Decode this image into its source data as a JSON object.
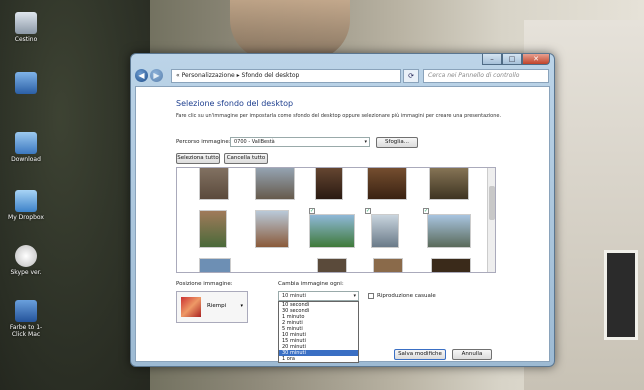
{
  "desktop": {
    "icons": [
      {
        "label": "Cestino",
        "icon": "recycle-bin-icon"
      },
      {
        "label": "",
        "icon": "computer-icon"
      },
      {
        "label": "Download",
        "icon": "download-folder-icon"
      },
      {
        "label": "My Dropbox",
        "icon": "dropbox-folder-icon"
      },
      {
        "label": "Skype ver.",
        "icon": "skype-icon"
      },
      {
        "label": "Farbe to 1-Click Mac",
        "icon": "shortcut-icon"
      }
    ]
  },
  "window": {
    "breadcrumb": "« Personalizzazione ▸ Sfondo del desktop",
    "search_placeholder": "Cerca nei Pannello di controllo",
    "title": "Selezione sfondo del desktop",
    "description": "Fare clic su un'immagine per impostarla come sfondo del desktop oppure selezionare più immagini per creare una presentazione.",
    "location_label": "Percorso immagine:",
    "location_value": "0700 - VallBestà",
    "browse_label": "Sfoglia...",
    "select_all_label": "Seleziona tutto",
    "clear_all_label": "Cancella tutto",
    "position_label": "Posizione immagine:",
    "position_value": "Riempi",
    "interval_label": "Cambia immagine ogni:",
    "interval_value": "10 minuti",
    "shuffle_label": "Riproduzione casuale",
    "interval_options": [
      "10 secondi",
      "30 secondi",
      "1 minuto",
      "2 minuti",
      "5 minuti",
      "10 minuti",
      "15 minuti",
      "20 minuti",
      "30 minuti",
      "1 ora"
    ],
    "selected_option_index": 8,
    "save_label": "Salva modifiche",
    "cancel_label": "Annulla"
  }
}
